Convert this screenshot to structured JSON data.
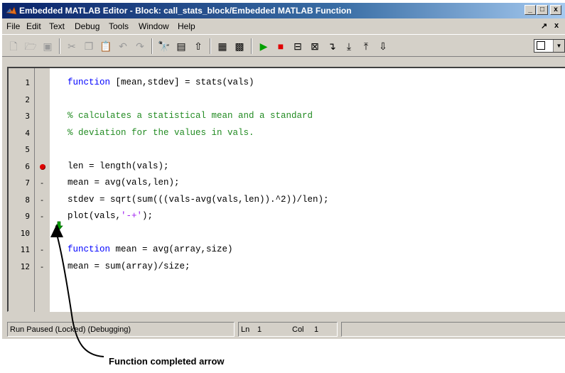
{
  "window": {
    "title": "Embedded MATLAB Editor - Block: call_stats_block/Embedded MATLAB Function",
    "buttons": [
      "_",
      "□",
      "x"
    ]
  },
  "menubar": {
    "items": [
      "File",
      "Edit",
      "Text",
      "Debug",
      "Tools",
      "Window",
      "Help"
    ],
    "right_controls": [
      "↗",
      "x"
    ]
  },
  "toolbar": {
    "icons": [
      "new-file-icon",
      "open-icon",
      "save-icon",
      "cut-icon",
      "copy-icon",
      "paste-icon",
      "undo-icon",
      "redo-icon",
      "find-icon",
      "show-block-icon",
      "go-to-parent-icon",
      "model-explorer-icon",
      "simulation-target-icon",
      "run-icon",
      "stop-icon",
      "set-breakpoint-icon",
      "clear-breakpoints-icon",
      "step-icon",
      "step-in-icon",
      "step-out-icon",
      "continue-icon",
      "stack-dropdown"
    ]
  },
  "editor": {
    "line_numbers": [
      "1",
      "2",
      "3",
      "4",
      "5",
      "6",
      "7",
      "8",
      "9",
      "10",
      "11",
      "12"
    ],
    "markers": [
      "",
      "",
      "",
      "",
      "",
      "breakpoint",
      "-",
      "-",
      "-",
      "",
      "-",
      "-"
    ],
    "lines": [
      [
        {
          "t": "function",
          "c": "kw"
        },
        {
          "t": " [mean,stdev] = stats(vals)",
          "c": ""
        }
      ],
      [],
      [
        {
          "t": "% calculates a statistical mean and a standard",
          "c": "cm"
        }
      ],
      [
        {
          "t": "% deviation for the values in vals.",
          "c": "cm"
        }
      ],
      [],
      [
        {
          "t": "len = length(vals);",
          "c": ""
        }
      ],
      [
        {
          "t": "mean = avg(vals,len);",
          "c": ""
        }
      ],
      [
        {
          "t": "stdev = sqrt(sum(((vals-avg(vals,len)).^2))/len);",
          "c": ""
        }
      ],
      [
        {
          "t": "plot(vals,",
          "c": ""
        },
        {
          "t": "'-+'",
          "c": "str"
        },
        {
          "t": ");",
          "c": ""
        }
      ],
      [],
      [
        {
          "t": "function",
          "c": "kw"
        },
        {
          "t": " mean = avg(array,size)",
          "c": ""
        }
      ],
      [
        {
          "t": "mean = sum(array)/size;",
          "c": ""
        }
      ]
    ]
  },
  "statusbar": {
    "status": "Run Paused (Locked) (Debugging)",
    "ln_label": "Ln",
    "ln_value": "1",
    "col_label": "Col",
    "col_value": "1"
  },
  "annotation": {
    "label": "Function completed arrow"
  },
  "colors": {
    "keyword": "#0000ff",
    "comment": "#228b22",
    "string": "#a020f0",
    "breakpoint": "#e00000",
    "completed_arrow": "#00a000"
  }
}
